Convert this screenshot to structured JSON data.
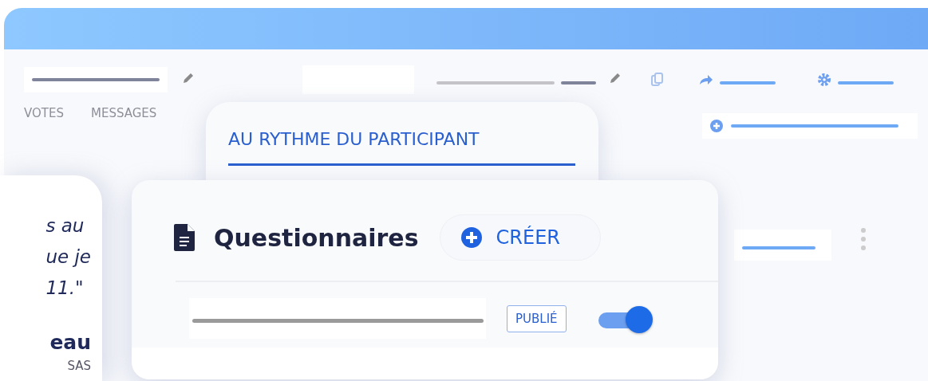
{
  "tabs": [
    {
      "label": "VOTES",
      "selected": false
    },
    {
      "label": "MESSAGES",
      "selected": false
    }
  ],
  "mode_tab": {
    "label": "AU RYTHME DU PARTICIPANT",
    "selected": true
  },
  "questionnaires": {
    "title": "Questionnaires",
    "create_button": "CRÉER",
    "items": [
      {
        "status": "PUBLIÉ",
        "on": true
      }
    ]
  },
  "testimonial": {
    "quote_lines": [
      "s au",
      "ue je",
      "11.\""
    ],
    "author": "eau",
    "company": "SAS"
  }
}
